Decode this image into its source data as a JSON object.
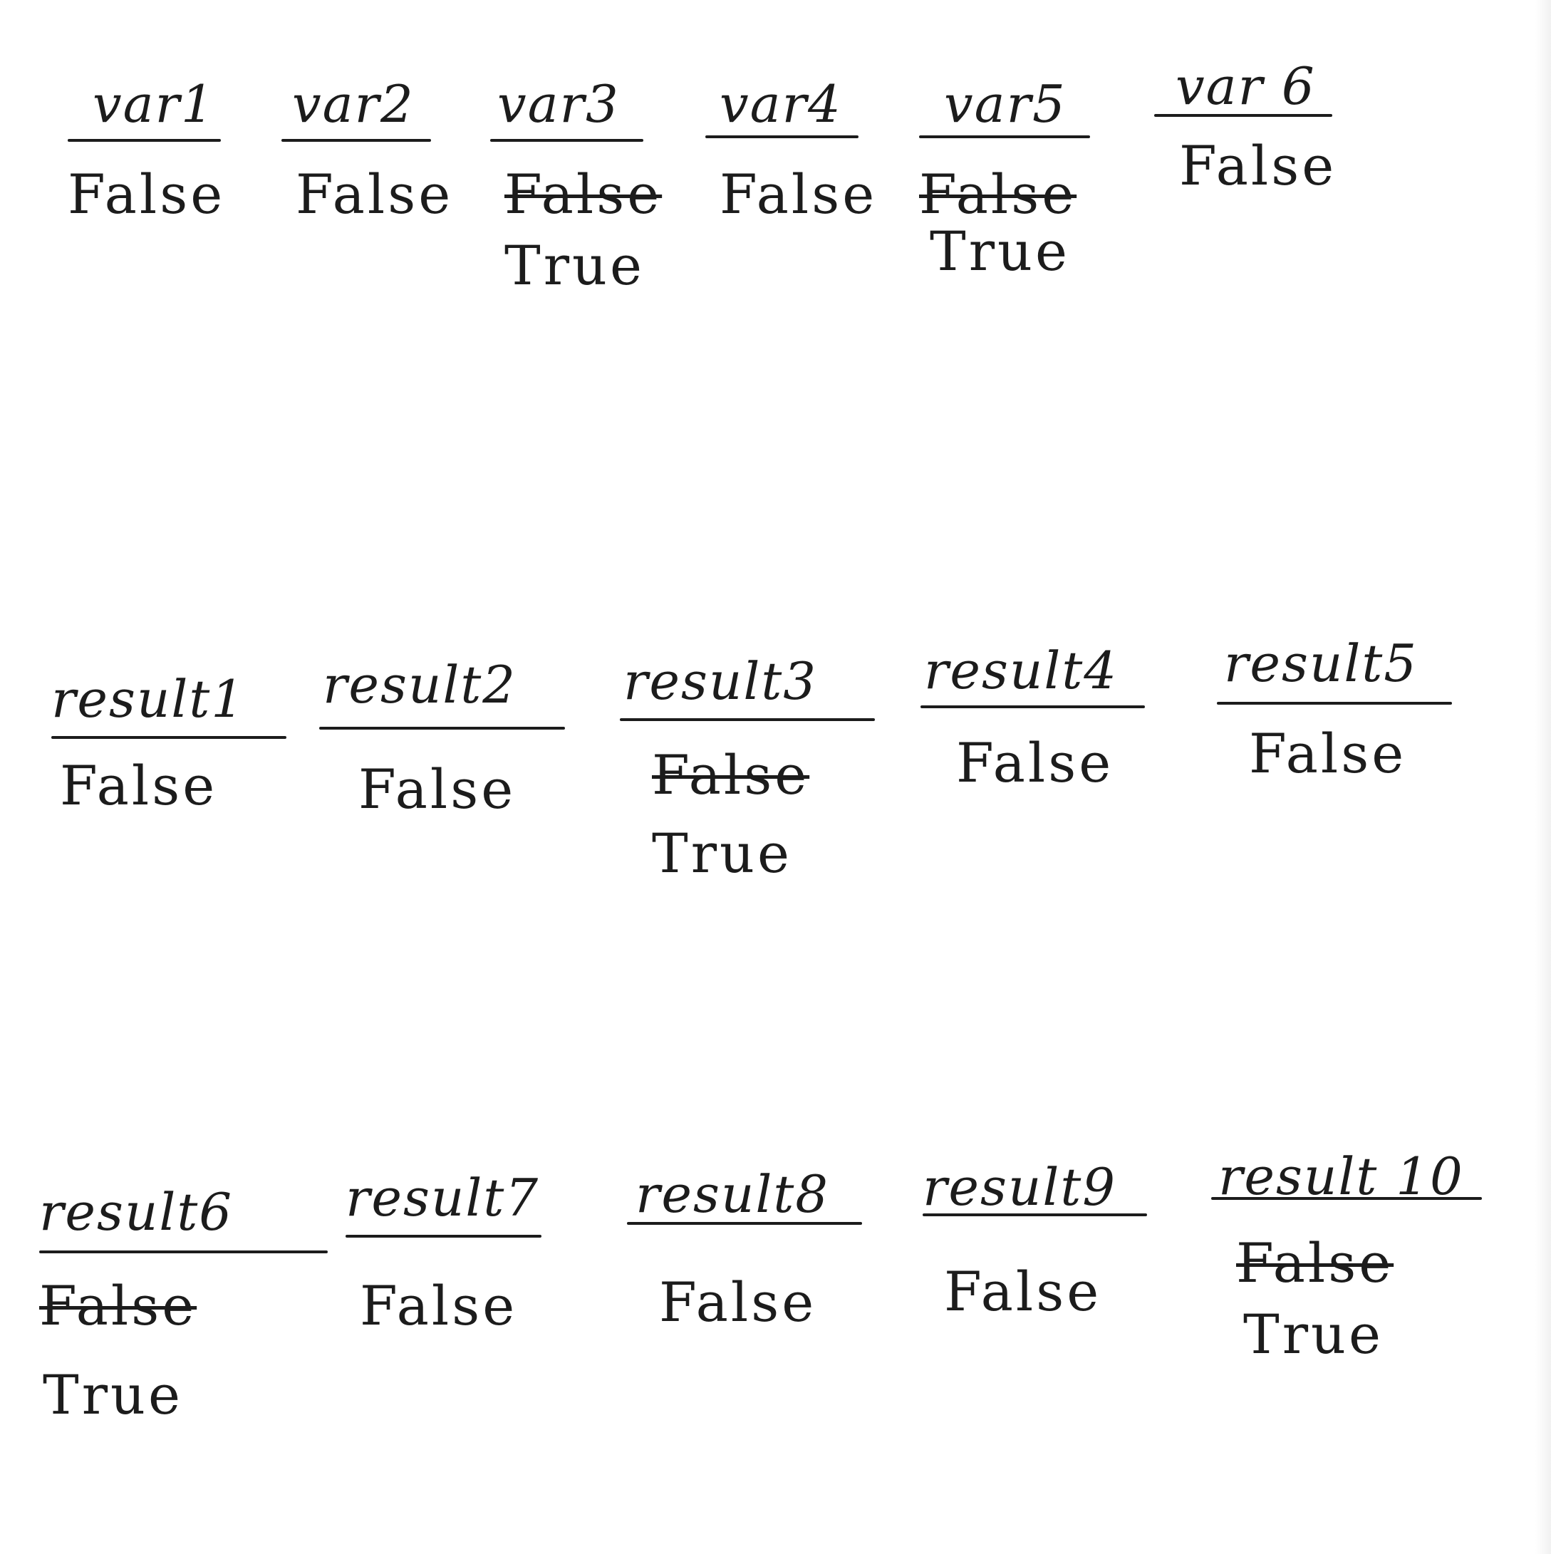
{
  "variables": [
    {
      "name": "var1",
      "value": "False"
    },
    {
      "name": "var2",
      "value": "False"
    },
    {
      "name": "var3",
      "value_crossed": "False",
      "value": "True"
    },
    {
      "name": "var4",
      "value": "False"
    },
    {
      "name": "var5",
      "value_crossed": "False",
      "value": "True"
    },
    {
      "name": "var 6",
      "value": "False"
    }
  ],
  "results_row1": [
    {
      "name": "result1",
      "value": "False"
    },
    {
      "name": "result2",
      "value": "False"
    },
    {
      "name": "result3",
      "value_crossed": "False",
      "value": "True"
    },
    {
      "name": "result4",
      "value": "False"
    },
    {
      "name": "result5",
      "value": "False"
    }
  ],
  "results_row2": [
    {
      "name": "result6",
      "value_crossed": "False",
      "value": "True"
    },
    {
      "name": "result7",
      "value": "False"
    },
    {
      "name": "result8",
      "value": "False"
    },
    {
      "name": "result9",
      "value": "False"
    },
    {
      "name": "result 10",
      "value_crossed": "False",
      "value": "True"
    }
  ]
}
